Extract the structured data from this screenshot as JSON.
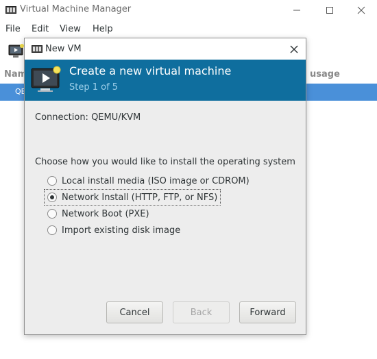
{
  "main_window": {
    "title": "Virtual Machine Manager",
    "menu": [
      "File",
      "Edit",
      "View",
      "Help"
    ],
    "list": {
      "columns": {
        "name": "Nam",
        "usage": "usage"
      },
      "selected_row": "QE"
    }
  },
  "dialog": {
    "title": "New VM",
    "banner": {
      "title": "Create a new virtual machine",
      "step": "Step 1 of 5"
    },
    "connection": {
      "label": "Connection:",
      "value": "QEMU/KVM"
    },
    "prompt": "Choose how you would like to install the operating system",
    "options": [
      {
        "label": "Local install media (ISO image or CDROM)",
        "checked": false
      },
      {
        "label": "Network Install (HTTP, FTP, or NFS)",
        "checked": true
      },
      {
        "label": "Network Boot (PXE)",
        "checked": false
      },
      {
        "label": "Import existing disk image",
        "checked": false
      }
    ],
    "buttons": {
      "cancel": "Cancel",
      "back": "Back",
      "forward": "Forward"
    }
  },
  "colors": {
    "banner": "#0f6e9e",
    "step_text": "#9fd0ea",
    "selection": "#4a90d9"
  }
}
